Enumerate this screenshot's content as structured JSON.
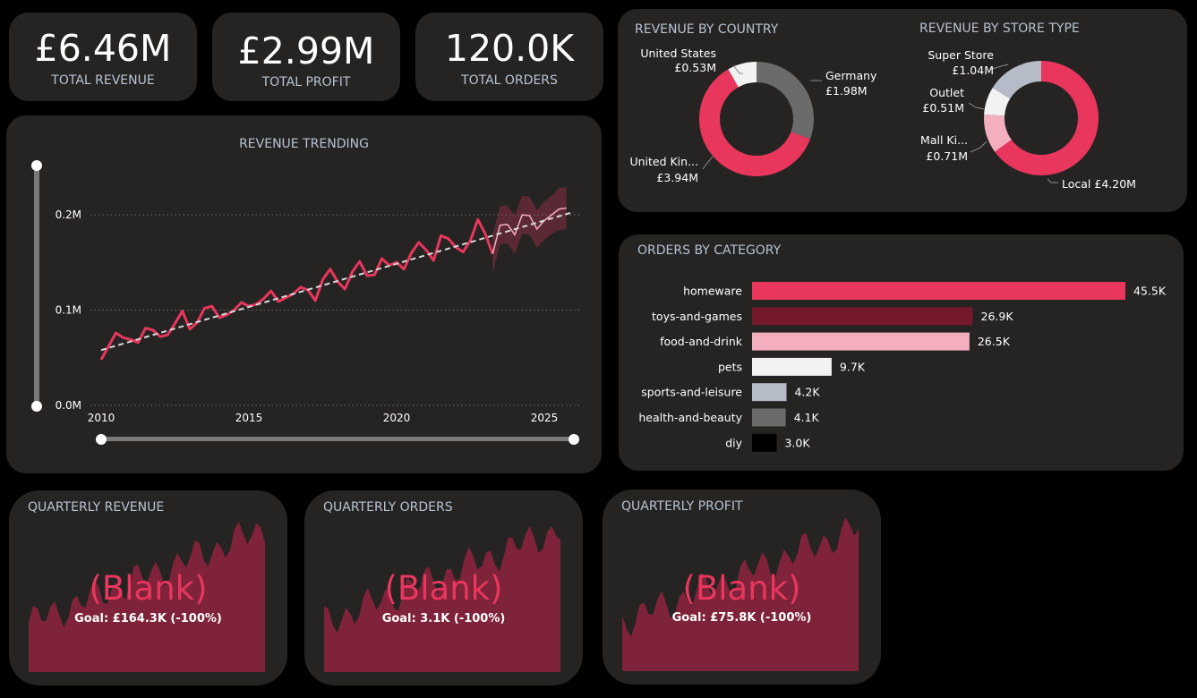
{
  "kpis": [
    {
      "value": "£6.46M",
      "label": "TOTAL REVENUE"
    },
    {
      "value": "£2.99M",
      "label": "TOTAL PROFIT"
    },
    {
      "value": "120.0K",
      "label": "TOTAL ORDERS"
    }
  ],
  "revenue_trending": {
    "title": "REVENUE TRENDING"
  },
  "revenue_by_country": {
    "title": "REVENUE BY COUNTRY",
    "slices": [
      {
        "name": "Germany",
        "value_label": "£1.98M",
        "value": 1.98,
        "color": "#6b6b6b"
      },
      {
        "name": "United Kin...",
        "value_label": "£3.94M",
        "value": 3.94,
        "color": "#e8365d"
      },
      {
        "name": "United States",
        "value_label": "£0.53M",
        "value": 0.53,
        "color": "#f2f2f2"
      }
    ]
  },
  "revenue_by_store_type": {
    "title": "REVENUE BY STORE TYPE",
    "slices": [
      {
        "name": "Local",
        "value_label": "£4.20M",
        "value": 4.2,
        "color": "#e8365d"
      },
      {
        "name": "Mall Ki...",
        "value_label": "£0.71M",
        "value": 0.71,
        "color": "#f4afbf"
      },
      {
        "name": "Outlet",
        "value_label": "£0.51M",
        "value": 0.51,
        "color": "#f2f2f2"
      },
      {
        "name": "Super Store",
        "value_label": "£1.04M",
        "value": 1.04,
        "color": "#b5bcc8"
      }
    ]
  },
  "orders_by_category": {
    "title": "ORDERS BY CATEGORY",
    "bars": [
      {
        "name": "homeware",
        "value": 45.5,
        "value_label": "45.5K",
        "color": "#e8365d"
      },
      {
        "name": "toys-and-games",
        "value": 26.9,
        "value_label": "26.9K",
        "color": "#74182c"
      },
      {
        "name": "food-and-drink",
        "value": 26.5,
        "value_label": "26.5K",
        "color": "#f4afbf"
      },
      {
        "name": "pets",
        "value": 9.7,
        "value_label": "9.7K",
        "color": "#f2f2f2"
      },
      {
        "name": "sports-and-leisure",
        "value": 4.2,
        "value_label": "4.2K",
        "color": "#b5bcc8"
      },
      {
        "name": "health-and-beauty",
        "value": 4.1,
        "value_label": "4.1K",
        "color": "#6b6b6b"
      },
      {
        "name": "diy",
        "value": 3.0,
        "value_label": "3.0K",
        "color": "#000000"
      }
    ]
  },
  "quarterly": [
    {
      "title": "QUARTERLY REVENUE",
      "value": "(Blank)",
      "goal": "Goal: £164.3K (-100%)"
    },
    {
      "title": "QUARTERLY ORDERS",
      "value": "(Blank)",
      "goal": "Goal: 3.1K (-100%)"
    },
    {
      "title": "QUARTERLY PROFIT",
      "value": "(Blank)",
      "goal": "Goal: £75.8K (-100%)"
    }
  ],
  "chart_data": {
    "type": "line",
    "title": "REVENUE TRENDING",
    "xlabel": "",
    "ylabel": "",
    "x_ticks": [
      2010,
      2015,
      2020,
      2025
    ],
    "y_ticks": [
      "0.0M",
      "0.1M",
      "0.2M"
    ],
    "xlim": [
      2010,
      2026
    ],
    "ylim": [
      0,
      0.2
    ],
    "grid": true,
    "series": [
      {
        "x": [
          2010.0,
          2010.25,
          2010.5,
          2010.75,
          2011.0,
          2011.25,
          2011.5,
          2011.75,
          2012.0,
          2012.25,
          2012.5,
          2012.75,
          2013.0,
          2013.25,
          2013.5,
          2013.75,
          2014.0,
          2014.25,
          2014.5,
          2014.75,
          2015.0,
          2015.25,
          2015.5,
          2015.75,
          2016.0,
          2016.25,
          2016.5,
          2016.75,
          2017.0,
          2017.25,
          2017.5,
          2017.75,
          2018.0,
          2018.25,
          2018.5,
          2018.75,
          2019.0,
          2019.25,
          2019.5,
          2019.75,
          2020.0,
          2020.25,
          2020.5,
          2020.75,
          2021.0,
          2021.25,
          2021.5,
          2021.75,
          2022.0,
          2022.25,
          2022.5,
          2022.75,
          2023.0,
          2023.25
        ],
        "y": [
          0.048,
          0.062,
          0.076,
          0.071,
          0.069,
          0.066,
          0.081,
          0.079,
          0.072,
          0.074,
          0.086,
          0.099,
          0.08,
          0.087,
          0.102,
          0.104,
          0.092,
          0.095,
          0.1,
          0.108,
          0.104,
          0.106,
          0.112,
          0.12,
          0.109,
          0.113,
          0.117,
          0.124,
          0.121,
          0.11,
          0.132,
          0.143,
          0.13,
          0.122,
          0.14,
          0.151,
          0.136,
          0.137,
          0.154,
          0.147,
          0.15,
          0.143,
          0.16,
          0.171,
          0.163,
          0.152,
          0.178,
          0.175,
          0.166,
          0.161,
          0.173,
          0.195,
          0.18,
          0.159
        ]
      },
      {
        "name": "forecast",
        "x": [
          2023.25,
          2023.5,
          2023.75,
          2024.0,
          2024.25,
          2024.5,
          2024.75,
          2025.0,
          2025.25,
          2025.5,
          2025.75
        ],
        "y": [
          0.159,
          0.189,
          0.19,
          0.179,
          0.2,
          0.199,
          0.185,
          0.194,
          0.2,
          0.206,
          0.207
        ],
        "band": [
          0.02,
          0.02,
          0.02,
          0.02,
          0.02,
          0.02,
          0.02,
          0.02,
          0.02,
          0.022,
          0.022
        ]
      },
      {
        "name": "trend",
        "x": [
          2010,
          2026
        ],
        "y": [
          0.058,
          0.203
        ]
      }
    ]
  },
  "colors": {
    "accent": "#e8365d",
    "area": "#7e2339",
    "card": "#252423",
    "muted": "#b8c2d2"
  }
}
